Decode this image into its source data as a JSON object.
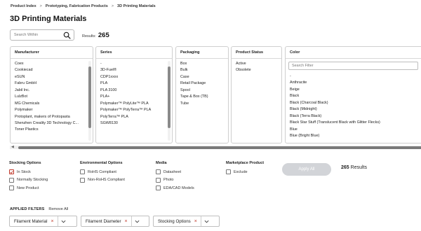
{
  "breadcrumb": {
    "items": [
      "Product Index",
      "Prototyping, Fabrication Products",
      "3D Printing Materials"
    ],
    "separator": ">"
  },
  "page": {
    "title": "3D Printing Materials"
  },
  "search": {
    "placeholder": "Search Within",
    "icon": "search-icon"
  },
  "results": {
    "label": "Results:",
    "count": "265"
  },
  "facets": {
    "manufacturer": {
      "title": "Manufacturer",
      "items": [
        "Coex",
        "Cookiecad",
        "eSUN",
        "Fabru GmbH",
        "Jabil Inc.",
        "LulzBot",
        "MG Chemicals",
        "Polymaker",
        "Protoplant, makers of Protopasta",
        "Shenzhen Creality 3D Technology C...",
        "Toner Plastics"
      ]
    },
    "series": {
      "title": "Series",
      "items": [
        "-",
        "3D-Fuel®",
        "CDP1xxxx",
        "PLA",
        "PLA 3100",
        "PLA+",
        "Polymaker™ PolyLite™ PLA",
        "Polymaker™ PolyTerra™ PLA",
        "PolyTerra™ PLA",
        "SGW8130"
      ]
    },
    "packaging": {
      "title": "Packaging",
      "items": [
        "Box",
        "Bulk",
        "Case",
        "Retail Package",
        "Spool",
        "Tape & Box (TB)",
        "Tube"
      ]
    },
    "product_status": {
      "title": "Product Status",
      "items": [
        "Active",
        "Obsolete"
      ]
    },
    "color": {
      "title": "Color",
      "filter_placeholder": "Search Filter",
      "items": [
        "-",
        "Anthracite",
        "Beige",
        "Black",
        "Black (Charcoal Black)",
        "Black (Midnight)",
        "Black (Terra Black)",
        "Black Star Stuff (Translucent Black with Glitter Flecks)",
        "Blue",
        "Blue (Bright Blue)"
      ]
    }
  },
  "options": {
    "stocking": {
      "title": "Stocking Options",
      "items": [
        {
          "label": "In Stock",
          "checked": true
        },
        {
          "label": "Normally Stocking",
          "checked": false
        },
        {
          "label": "New Product",
          "checked": false
        }
      ]
    },
    "environmental": {
      "title": "Environmental Options",
      "items": [
        {
          "label": "RoHS Compliant",
          "checked": false
        },
        {
          "label": "Non-RoHS Compliant",
          "checked": false
        }
      ]
    },
    "media": {
      "title": "Media",
      "items": [
        {
          "label": "Datasheet",
          "checked": false
        },
        {
          "label": "Photo",
          "checked": false
        },
        {
          "label": "EDA/CAD Models",
          "checked": false
        }
      ]
    },
    "marketplace": {
      "title": "Marketplace Product",
      "items": [
        {
          "label": "Exclude",
          "checked": false
        }
      ]
    }
  },
  "apply_button": {
    "label": "Apply All"
  },
  "results_right": {
    "count": "265",
    "label": "Results"
  },
  "applied_filters": {
    "title": "APPLIED FILTERS",
    "remove_all": "Remove All",
    "chips": [
      {
        "label": "Filament Material",
        "remove": "×"
      },
      {
        "label": "Filament Diameter",
        "remove": "×"
      },
      {
        "label": "Stocking Options",
        "remove": "×"
      }
    ]
  },
  "colors": {
    "accent_red": "#c0392b",
    "apply_disabled": "#d2d4d8",
    "border": "#cfcfcf"
  }
}
